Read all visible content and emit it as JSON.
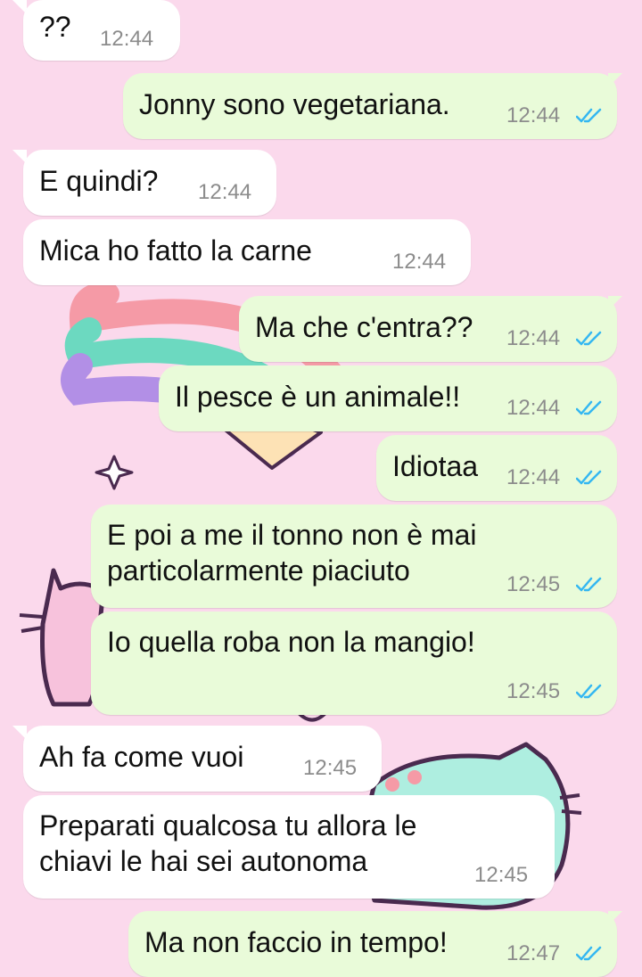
{
  "conversation": {
    "messages": [
      {
        "direction": "in",
        "text": "??",
        "time": "12:44"
      },
      {
        "direction": "out",
        "text": "Jonny sono vegetariana.",
        "time": "12:44",
        "status": "read"
      },
      {
        "direction": "in",
        "text": "E quindi?",
        "time": "12:44"
      },
      {
        "direction": "in",
        "text": "Mica ho fatto la carne",
        "time": "12:44"
      },
      {
        "direction": "out",
        "text": "Ma che c'entra??",
        "time": "12:44",
        "status": "read"
      },
      {
        "direction": "out",
        "text": "Il pesce è un animale!!",
        "time": "12:44",
        "status": "read"
      },
      {
        "direction": "out",
        "text": "Idiotaa",
        "time": "12:44",
        "status": "read"
      },
      {
        "direction": "out",
        "text": "E poi a me il tonno non è mai\nparticolarmente piaciuto",
        "time": "12:45",
        "status": "read"
      },
      {
        "direction": "out",
        "text": "Io quella roba non la mangio!",
        "time": "12:45",
        "status": "read"
      },
      {
        "direction": "in",
        "text": "Ah fa come vuoi",
        "time": "12:45"
      },
      {
        "direction": "in",
        "text": "Preparati qualcosa tu allora le\nchiavi le hai sei autonoma",
        "time": "12:45"
      },
      {
        "direction": "out",
        "text": "Ma non faccio in tempo!",
        "time": "12:47",
        "status": "read"
      }
    ]
  },
  "colors": {
    "background": "#fbd9ec",
    "incoming_bubble": "#ffffff",
    "outgoing_bubble": "#e9fbd9",
    "read_ticks": "#34b7f1",
    "timestamp": "#8c8c8c"
  },
  "wallpaper": {
    "motifs": [
      "rainbow-star-icon",
      "sparkle-icon",
      "pink-cat-icon",
      "mint-cat-icon"
    ]
  }
}
